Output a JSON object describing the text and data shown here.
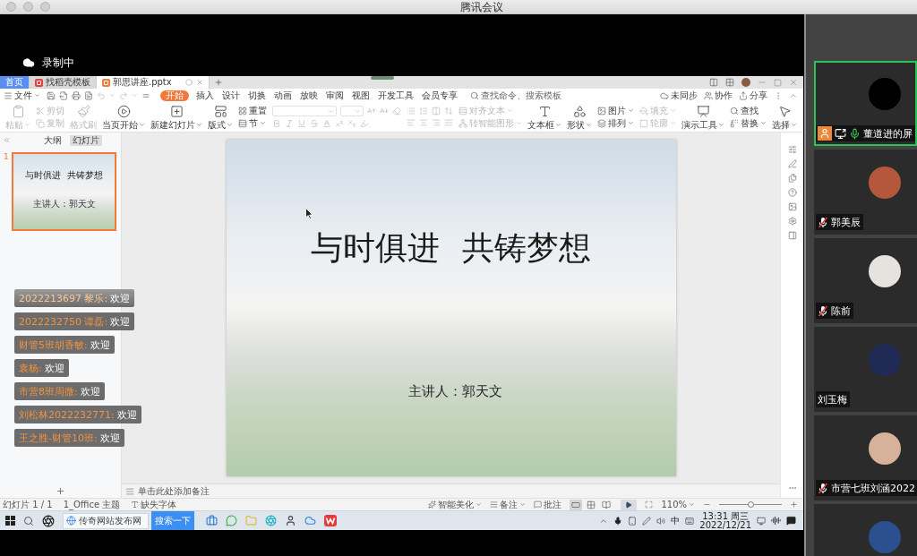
{
  "window": {
    "title": "腾讯会议"
  },
  "recording": {
    "label": "录制中"
  },
  "wps": {
    "tabs": [
      {
        "label": "首页",
        "kind": "home",
        "selected": false
      },
      {
        "label": "找稻壳模板",
        "kind": "web",
        "selected": false
      },
      {
        "label": "郭思讲座.pptx",
        "kind": "document",
        "selected": true
      }
    ],
    "file_menu": "文件",
    "menu": [
      {
        "label": "开始",
        "selected": true
      },
      {
        "label": "插入",
        "selected": false
      },
      {
        "label": "设计",
        "selected": false
      },
      {
        "label": "切换",
        "selected": false
      },
      {
        "label": "动画",
        "selected": false
      },
      {
        "label": "放映",
        "selected": false
      },
      {
        "label": "审阅",
        "selected": false
      },
      {
        "label": "视图",
        "selected": false
      },
      {
        "label": "开发工具",
        "selected": false
      },
      {
        "label": "会员专享",
        "selected": false
      }
    ],
    "command_search": {
      "placeholder": "查找命令、搜索模板"
    },
    "actions": [
      "未同步",
      "协作",
      "分享"
    ],
    "ribbon": [
      {
        "kind": "large",
        "label": "粘贴",
        "dropdown": true,
        "disabled": true
      },
      {
        "kind": "stack",
        "items": [
          {
            "label": "剪切",
            "dropdown": false,
            "disabled": true
          },
          {
            "label": "复制",
            "dropdown": false,
            "disabled": true
          }
        ]
      },
      {
        "kind": "large",
        "label": "格式刷",
        "dropdown": false,
        "disabled": true
      },
      {
        "kind": "large",
        "label": "当页开始",
        "dropdown": true,
        "disabled": false
      },
      {
        "kind": "large",
        "label": "新建幻灯片",
        "dropdown": true,
        "disabled": false
      },
      {
        "kind": "large",
        "label": "版式",
        "dropdown": true,
        "disabled": false
      },
      {
        "kind": "stack",
        "items": [
          {
            "label": "重置",
            "dropdown": false,
            "disabled": false
          },
          {
            "label": "节",
            "dropdown": true,
            "disabled": false
          }
        ]
      },
      {
        "kind": "font",
        "disabled": true
      },
      {
        "kind": "paragraph",
        "disabled": true
      },
      {
        "kind": "stack",
        "items": [
          {
            "label": "对齐文本",
            "dropdown": true,
            "disabled": true
          },
          {
            "label": "转智能图形",
            "dropdown": true,
            "disabled": true
          }
        ]
      },
      {
        "kind": "large",
        "label": "文本框",
        "dropdown": true,
        "disabled": false
      },
      {
        "kind": "large",
        "label": "形状",
        "dropdown": true,
        "disabled": false
      },
      {
        "kind": "stack",
        "items": [
          {
            "label": "图片",
            "dropdown": true,
            "disabled": false
          },
          {
            "label": "排列",
            "dropdown": true,
            "disabled": false
          }
        ]
      },
      {
        "kind": "stack",
        "items": [
          {
            "label": "填充",
            "dropdown": true,
            "disabled": true
          },
          {
            "label": "轮廓",
            "dropdown": true,
            "disabled": true
          }
        ]
      },
      {
        "kind": "large",
        "label": "演示工具",
        "dropdown": true,
        "disabled": false
      },
      {
        "kind": "stack",
        "items": [
          {
            "label": "查找",
            "dropdown": false,
            "disabled": false
          },
          {
            "label": "替换",
            "dropdown": true,
            "disabled": false
          }
        ]
      },
      {
        "kind": "large",
        "label": "选择",
        "dropdown": true,
        "disabled": false
      }
    ],
    "panel_tabs": [
      {
        "label": "大纲",
        "selected": false
      },
      {
        "label": "幻灯片",
        "selected": true
      }
    ],
    "thumbnails": [
      {
        "number": "1",
        "title": "与时俱进 共铸梦想",
        "subtitle": "主讲人：郭天文",
        "selected": true
      }
    ],
    "slide": {
      "title": "与时俱进 共铸梦想",
      "subtitle": "主讲人：郭天文"
    },
    "notes": {
      "placeholder": "单击此处添加备注"
    },
    "status": {
      "slide": "幻灯片 1 / 1",
      "theme": "1_Office 主题",
      "fonts": "缺失字体",
      "beautify": "智能美化",
      "notes": "备注",
      "comments": "批注",
      "views": [
        {
          "selected": true
        },
        {
          "selected": false
        },
        {
          "selected": false
        }
      ],
      "zoom": "110%",
      "zoom_slider": {
        "level": 0.5
      }
    }
  },
  "chat": [
    {
      "sender": "2022213697 黎乐:",
      "text": "欢迎",
      "fading": true
    },
    {
      "sender": "2022232750 谭磊:",
      "text": "欢迎",
      "fading": false
    },
    {
      "sender": "财管5班胡香敏:",
      "text": "欢迎",
      "fading": false
    },
    {
      "sender": "袁杨:",
      "text": "欢迎",
      "fading": false
    },
    {
      "sender": "市营8班周微:",
      "text": "欢迎",
      "fading": false
    },
    {
      "sender": "刘松林2022232771:",
      "text": "欢迎",
      "fading": false
    },
    {
      "sender": "王之胜-财管10班:",
      "text": "欢迎",
      "fading": false
    }
  ],
  "taskbar": {
    "search": {
      "placeholder": "传奇网站发布网"
    },
    "search_button": "搜索一下",
    "ime": "中",
    "time": "13:31 周三",
    "date": "2022/12/21"
  },
  "participants": [
    {
      "name": "董道进的屏",
      "mic_on": true,
      "muted": false,
      "speaking": true,
      "host": true,
      "sharing": true,
      "color": "#000000"
    },
    {
      "name": "郭美辰",
      "mic_on": false,
      "muted": true,
      "speaking": false,
      "host": false,
      "sharing": false,
      "color": "#b5573a"
    },
    {
      "name": "陈前",
      "mic_on": false,
      "muted": true,
      "speaking": false,
      "host": false,
      "sharing": false,
      "color": "#e6e2de"
    },
    {
      "name": "刘玉梅",
      "mic_on": false,
      "muted": false,
      "speaking": false,
      "host": false,
      "sharing": false,
      "color": "#1f2a55"
    },
    {
      "name": "市营七班刘涵2022",
      "mic_on": false,
      "muted": true,
      "speaking": false,
      "host": false,
      "sharing": false,
      "color": "#d6b29a"
    },
    {
      "mic_on": false,
      "muted": false,
      "speaking": false,
      "host": false,
      "sharing": false,
      "color": "#2b4f8f"
    }
  ]
}
